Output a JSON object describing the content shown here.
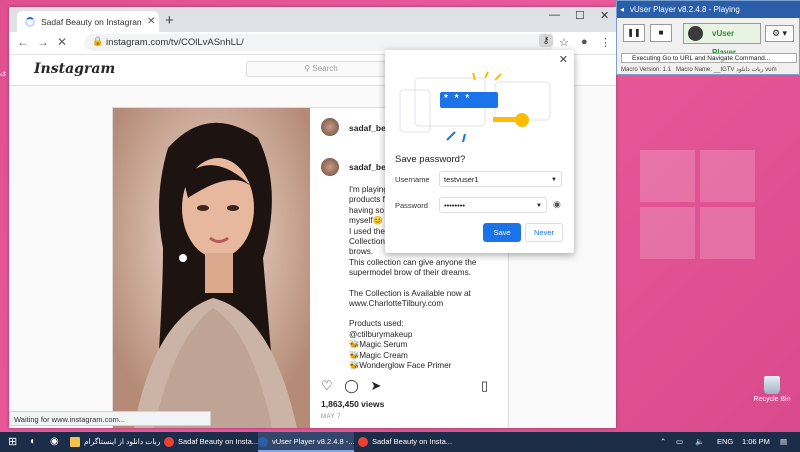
{
  "desktop": {
    "corner_text": "ى",
    "recycle_label": "Recycle Bin"
  },
  "browser": {
    "tab_title": "Sadaf Beauty on Instagram: \"I'm",
    "url": "instagram.com/tv/COlLvASnhLL/",
    "status_text": "Waiting for www.instagram.com..."
  },
  "instagram": {
    "logo": "Instagram",
    "search_placeholder": "Search",
    "username_header": "sadaf_bea",
    "username_caption": "sadaf_bea",
    "caption_lines": [
      "I'm playing",
      "products f",
      "having so",
      "myself😊",
      "I used the",
      "Collection",
      "brows.",
      "This collection can give anyone the",
      "supermodel brow of their dreams.",
      "",
      "The Collection is Available now at",
      "www.CharlotteTilbury.com",
      "",
      "Products used:",
      "@ctilburymakeup",
      "🐝Magic Serum",
      "🐝Magic Cream",
      "🐝Wonderglow Face Primer"
    ],
    "views": "1,863,450 views",
    "date": "MAY 7"
  },
  "password_popup": {
    "title": "Save password?",
    "username_label": "Username",
    "username_value": "testvuser1",
    "password_label": "Password",
    "password_value": "••••••••",
    "save_label": "Save",
    "never_label": "Never",
    "art_mask": "* * *"
  },
  "vuser": {
    "title": "vUser Player v8.2.4.8 - Playing",
    "logo_text": "vUser Player",
    "status": "Executing Go to URL and Navigate Command...",
    "macro_version": "Macro Version: 1.1",
    "macro_name": "Macro Name: __IGTV ربات دانلود vum"
  },
  "taskbar": {
    "items": [
      {
        "label": "ربات دانلود از اینستاگرام"
      },
      {
        "label": "Sadaf Beauty on Insta..."
      },
      {
        "label": "vUser Player v8.2.4.8 -..."
      },
      {
        "label": "Sadaf Beauty on Insta..."
      }
    ],
    "lang": "ENG",
    "time": "1:06 PM"
  },
  "colors": {
    "accent": "#1a73e8",
    "desktop": "#e0508f",
    "titlebar": "#2a5ea8",
    "taskbar": "#1b2d48"
  }
}
